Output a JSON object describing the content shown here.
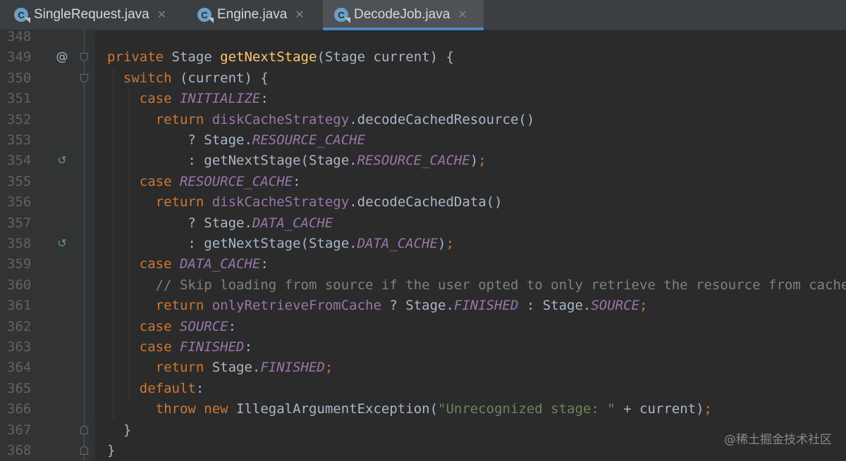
{
  "tabs": [
    {
      "label": "SingleRequest.java",
      "icon": "C",
      "active": false
    },
    {
      "label": "Engine.java",
      "icon": "C",
      "active": false
    },
    {
      "label": "DecodeJob.java",
      "icon": "C",
      "active": true
    }
  ],
  "tab_close_glyph": "✕",
  "colors": {
    "keyword": "#cc7832",
    "method": "#ffc66d",
    "constant": "#9876aa",
    "comment": "#808080",
    "string": "#6a8759",
    "plain": "#a9b7c6",
    "active_tab_underline": "#4a88c7"
  },
  "gutter_marks": {
    "349": "@",
    "354": "↺",
    "358": "↺"
  },
  "lines": [
    {
      "num": "348",
      "tokens": []
    },
    {
      "num": "349",
      "tokens": [
        [
          "kw",
          "private "
        ],
        [
          "p",
          "Stage "
        ],
        [
          "fn",
          "getNextStage"
        ],
        [
          "p",
          "(Stage current) {"
        ]
      ]
    },
    {
      "num": "350",
      "tokens": [
        [
          "p",
          "  "
        ],
        [
          "kw",
          "switch "
        ],
        [
          "p",
          "(current) {"
        ]
      ]
    },
    {
      "num": "351",
      "tokens": [
        [
          "p",
          "    "
        ],
        [
          "kw",
          "case "
        ],
        [
          "cst",
          "INITIALIZE"
        ],
        [
          "p",
          ":"
        ]
      ]
    },
    {
      "num": "352",
      "tokens": [
        [
          "p",
          "      "
        ],
        [
          "kw",
          "return "
        ],
        [
          "fld",
          "diskCacheStrategy"
        ],
        [
          "p",
          ".decodeCachedResource()"
        ]
      ]
    },
    {
      "num": "353",
      "tokens": [
        [
          "p",
          "          ? Stage."
        ],
        [
          "cst",
          "RESOURCE_CACHE"
        ]
      ]
    },
    {
      "num": "354",
      "tokens": [
        [
          "p",
          "          : getNextStage(Stage."
        ],
        [
          "cst",
          "RESOURCE_CACHE"
        ],
        [
          "p",
          ")"
        ],
        [
          "kw",
          ";"
        ]
      ]
    },
    {
      "num": "355",
      "tokens": [
        [
          "p",
          "    "
        ],
        [
          "kw",
          "case "
        ],
        [
          "cst",
          "RESOURCE_CACHE"
        ],
        [
          "p",
          ":"
        ]
      ]
    },
    {
      "num": "356",
      "tokens": [
        [
          "p",
          "      "
        ],
        [
          "kw",
          "return "
        ],
        [
          "fld",
          "diskCacheStrategy"
        ],
        [
          "p",
          ".decodeCachedData()"
        ]
      ]
    },
    {
      "num": "357",
      "tokens": [
        [
          "p",
          "          ? Stage."
        ],
        [
          "cst",
          "DATA_CACHE"
        ]
      ]
    },
    {
      "num": "358",
      "tokens": [
        [
          "p",
          "          : getNextStage(Stage."
        ],
        [
          "cst",
          "DATA_CACHE"
        ],
        [
          "p",
          ")"
        ],
        [
          "kw",
          ";"
        ]
      ]
    },
    {
      "num": "359",
      "tokens": [
        [
          "p",
          "    "
        ],
        [
          "kw",
          "case "
        ],
        [
          "cst",
          "DATA_CACHE"
        ],
        [
          "p",
          ":"
        ]
      ]
    },
    {
      "num": "360",
      "tokens": [
        [
          "p",
          "      "
        ],
        [
          "cmt",
          "// Skip loading from source if the user opted to only retrieve the resource from cache."
        ]
      ]
    },
    {
      "num": "361",
      "tokens": [
        [
          "p",
          "      "
        ],
        [
          "kw",
          "return "
        ],
        [
          "fld",
          "onlyRetrieveFromCache"
        ],
        [
          "p",
          " ? Stage."
        ],
        [
          "cst",
          "FINISHED"
        ],
        [
          "p",
          " : Stage."
        ],
        [
          "cst",
          "SOURCE"
        ],
        [
          "kw",
          ";"
        ]
      ]
    },
    {
      "num": "362",
      "tokens": [
        [
          "p",
          "    "
        ],
        [
          "kw",
          "case "
        ],
        [
          "cst",
          "SOURCE"
        ],
        [
          "p",
          ":"
        ]
      ]
    },
    {
      "num": "363",
      "tokens": [
        [
          "p",
          "    "
        ],
        [
          "kw",
          "case "
        ],
        [
          "cst",
          "FINISHED"
        ],
        [
          "p",
          ":"
        ]
      ]
    },
    {
      "num": "364",
      "tokens": [
        [
          "p",
          "      "
        ],
        [
          "kw",
          "return "
        ],
        [
          "p",
          "Stage."
        ],
        [
          "cst",
          "FINISHED"
        ],
        [
          "kw",
          ";"
        ]
      ]
    },
    {
      "num": "365",
      "tokens": [
        [
          "p",
          "    "
        ],
        [
          "kw",
          "default"
        ],
        [
          "p",
          ":"
        ]
      ]
    },
    {
      "num": "366",
      "tokens": [
        [
          "p",
          "      "
        ],
        [
          "kw",
          "throw new "
        ],
        [
          "p",
          "IllegalArgumentException("
        ],
        [
          "str",
          "\"Unrecognized stage: \""
        ],
        [
          "p",
          " + current)"
        ],
        [
          "kw",
          ";"
        ]
      ]
    },
    {
      "num": "367",
      "tokens": [
        [
          "p",
          "  }"
        ]
      ]
    },
    {
      "num": "368",
      "tokens": [
        [
          "p",
          "}"
        ]
      ]
    }
  ],
  "watermark": "@稀土掘金技术社区"
}
